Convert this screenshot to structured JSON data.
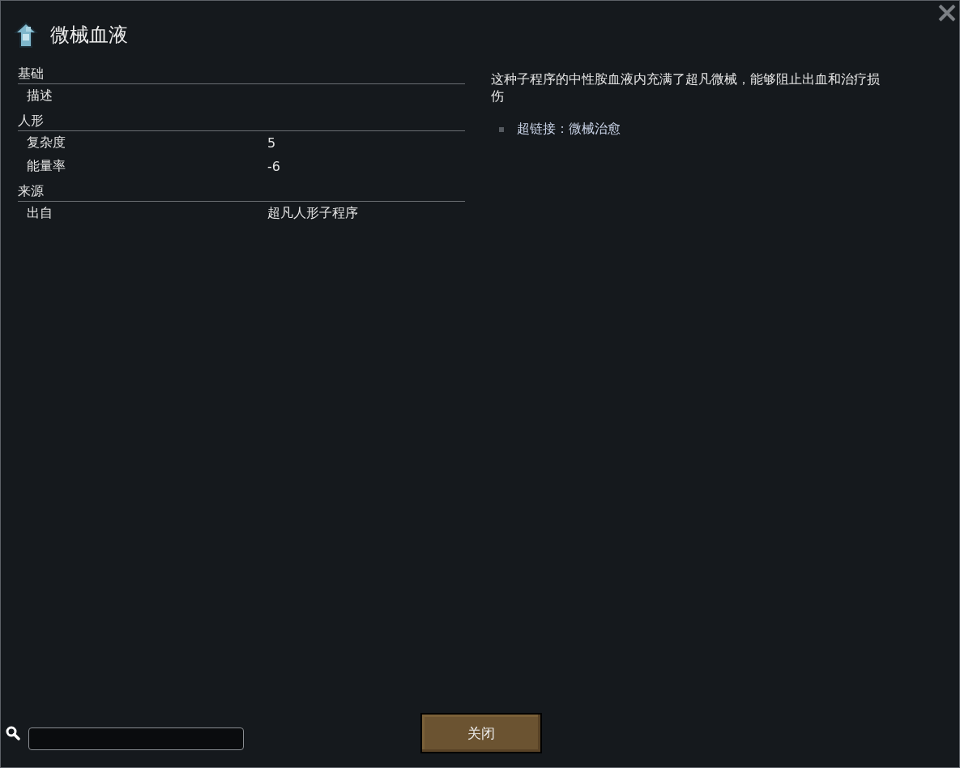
{
  "window": {
    "title": "微械血液"
  },
  "sections": [
    {
      "heading": "基础",
      "rows": [
        {
          "label": "描述"
        }
      ]
    },
    {
      "heading": "人形",
      "rows": [
        {
          "label": "复杂度",
          "value": "5"
        },
        {
          "label": "能量率",
          "value": "-6"
        }
      ]
    },
    {
      "heading": "来源",
      "rows": [
        {
          "label": "出自",
          "value": "超凡人形子程序"
        }
      ]
    }
  ],
  "description": "这种子程序的中性胺血液内充满了超凡微械，能够阻止出血和治疗损伤",
  "links": [
    "超链接：微械治愈"
  ],
  "buttons": [
    "关闭"
  ]
}
